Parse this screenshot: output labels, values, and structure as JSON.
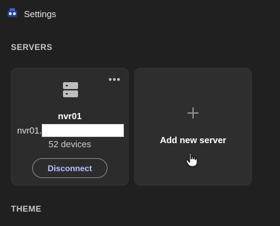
{
  "window": {
    "title": "Settings",
    "app_icon": "app-logo-icon"
  },
  "sections": {
    "servers_heading": "SERVERS",
    "theme_heading": "THEME"
  },
  "server_card": {
    "icon": "server-icon",
    "more_icon": "more-options-icon",
    "name": "nvr01",
    "host_prefix": "nvr01.",
    "devices": "52 devices",
    "disconnect_label": "Disconnect"
  },
  "add_card": {
    "icon": "plus-icon",
    "label": "Add new server"
  },
  "colors": {
    "background": "#202020",
    "card": "#2c2c2c",
    "accent": "#b8c4ff"
  }
}
